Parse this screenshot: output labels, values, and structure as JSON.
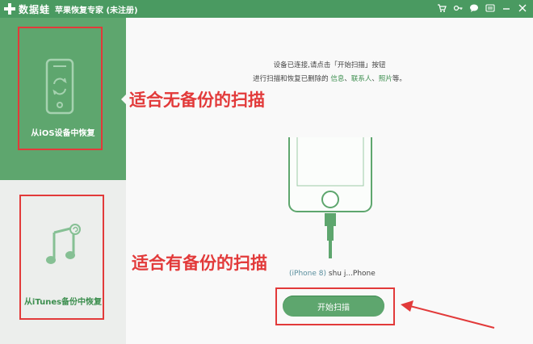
{
  "titlebar": {
    "brand": "数据蛙",
    "app_title": "苹果恢复专家 (未注册)",
    "icons": [
      "cart-icon",
      "key-icon",
      "chat-icon",
      "menu-icon",
      "minimize-icon",
      "close-icon"
    ]
  },
  "sidebar": {
    "items": [
      {
        "label": "从iOS设备中恢复",
        "icon": "phone-restore-icon",
        "active": true
      },
      {
        "label": "从iTunes备份中恢复",
        "icon": "music-note-icon",
        "active": false
      }
    ]
  },
  "main": {
    "notice_line1": "设备已连接,请点击「开始扫描」按钮",
    "notice_line2_prefix": "进行扫描和恢复已删除的",
    "notice_links": [
      "信息",
      "联系人",
      "照片"
    ],
    "notice_sep": "、",
    "notice_suffix": "等。",
    "device_model": "(iPhone 8)",
    "device_name": "shu j...Phone",
    "start_button": "开始扫描"
  },
  "annotations": {
    "annot1": "适合无备份的扫描",
    "annot2": "适合有备份的扫描"
  },
  "colors": {
    "accent": "#5ea66e",
    "titlebar": "#4a9a61",
    "annotation": "#e23a3a"
  }
}
